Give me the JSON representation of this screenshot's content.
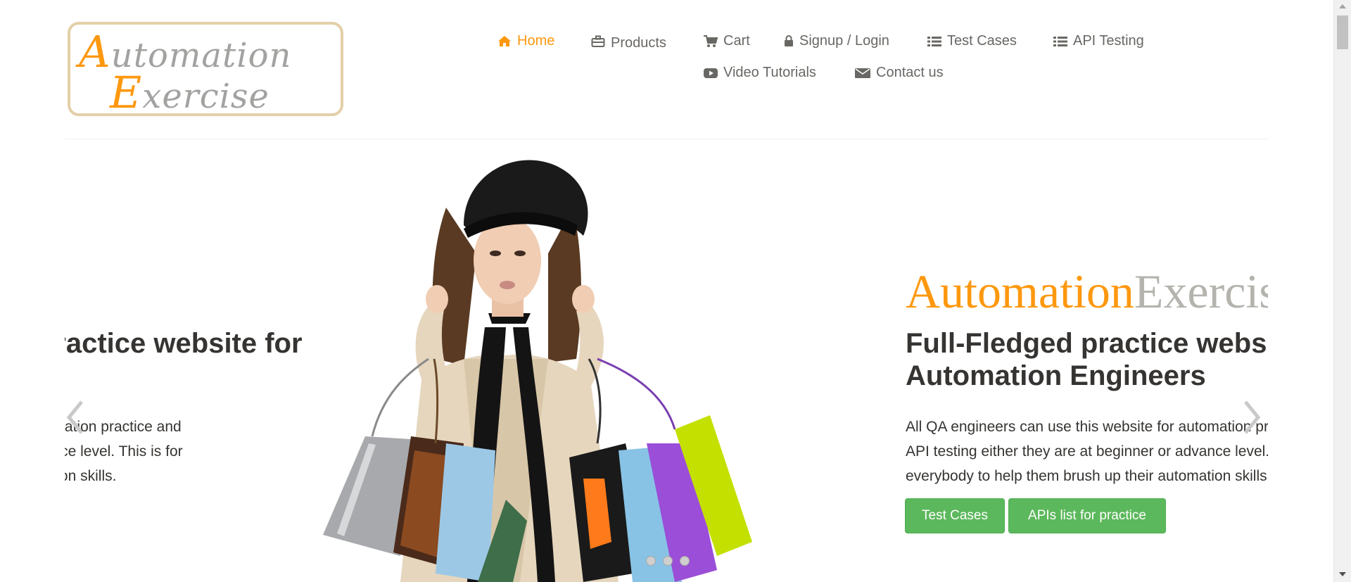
{
  "logo": {
    "line1_cap": "A",
    "line1_rest": "utomation",
    "line2_cap": "E",
    "line2_rest": "xercise"
  },
  "nav": {
    "row1": [
      {
        "label": "Home",
        "icon": "home-icon",
        "active": true
      },
      {
        "label": "Products",
        "icon": "briefcase-icon"
      },
      {
        "label": "Cart",
        "icon": "cart-icon"
      },
      {
        "label": "Signup / Login",
        "icon": "lock-icon"
      },
      {
        "label": "Test Cases",
        "icon": "list-icon"
      },
      {
        "label": "API Testing",
        "icon": "list-icon"
      }
    ],
    "row2": [
      {
        "label": "Video Tutorials",
        "icon": "youtube-play-icon"
      },
      {
        "label": "Contact us",
        "icon": "envelope-icon"
      }
    ]
  },
  "slider": {
    "brand_orange": "Automation",
    "brand_grey": "Exercise",
    "heading_line1": "Full-Fledged practice website for",
    "heading_line2": "Automation Engineers",
    "para_line1": "All QA engineers can use this website for automation practice and",
    "para_line2": "API testing either they are at beginner or advance level. This is for",
    "para_line3": "everybody to help them brush up their automation skills.",
    "btn_test_cases": "Test Cases",
    "btn_apis": "APIs list for practice"
  },
  "colors": {
    "accent": "#fe980f",
    "button_green": "#5cb85c",
    "text_dark": "#363432",
    "text_grey": "#696763"
  }
}
